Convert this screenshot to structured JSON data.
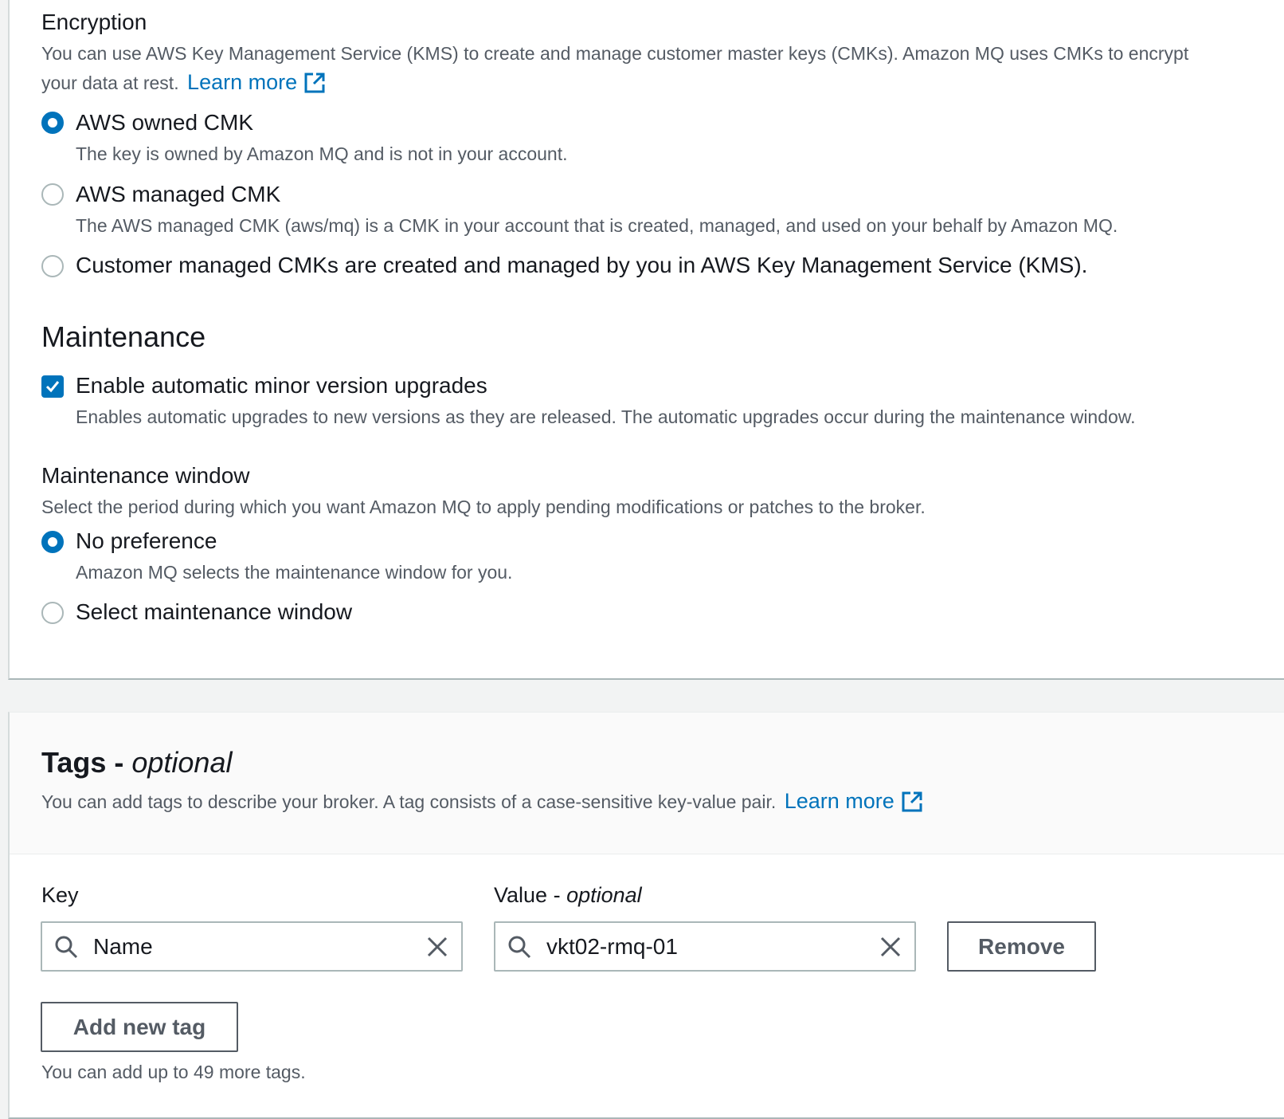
{
  "encryption": {
    "title": "Encryption",
    "description": "You can use AWS Key Management Service (KMS) to create and manage customer master keys (CMKs). Amazon MQ uses CMKs to encrypt",
    "description_line2": "your data at rest.",
    "learn_more": "Learn more",
    "options": [
      {
        "label": "AWS owned CMK",
        "description": "The key is owned by Amazon MQ and is not in your account.",
        "checked": true
      },
      {
        "label": "AWS managed CMK",
        "description": "The AWS managed CMK (aws/mq) is a CMK in your account that is created, managed, and used on your behalf by Amazon MQ.",
        "checked": false
      },
      {
        "label": "Customer managed CMKs are created and managed by you in AWS Key Management Service (KMS).",
        "checked": false
      }
    ]
  },
  "maintenance": {
    "title": "Maintenance",
    "auto_upgrade": {
      "label": "Enable automatic minor version upgrades",
      "description": "Enables automatic upgrades to new versions as they are released. The automatic upgrades occur during the maintenance window.",
      "checked": true
    },
    "window": {
      "title": "Maintenance window",
      "description": "Select the period during which you want Amazon MQ to apply pending modifications or patches to the broker.",
      "options": [
        {
          "label": "No preference",
          "description": "Amazon MQ selects the maintenance window for you.",
          "checked": true
        },
        {
          "label": "Select maintenance window",
          "checked": false
        }
      ]
    }
  },
  "tags": {
    "title": "Tags",
    "title_sep": " - ",
    "title_optional": "optional",
    "description": "You can add tags to describe your broker. A tag consists of a case-sensitive key-value pair.",
    "learn_more": "Learn more",
    "key_label": "Key",
    "value_label": "Value",
    "value_label_sep": " - ",
    "value_label_optional": "optional",
    "key_value": "Name",
    "value_value": "vkt02-rmq-01",
    "remove_button": "Remove",
    "add_button": "Add new tag",
    "limit_text": "You can add up to 49 more tags."
  },
  "icons": {
    "external_link": "external-link-icon",
    "search": "search-icon",
    "clear": "close-icon",
    "checkmark": "checkmark-icon"
  },
  "colors": {
    "accent": "#0073bb",
    "text": "#16191f",
    "secondary_text": "#545b64",
    "background": "#f2f3f3"
  }
}
